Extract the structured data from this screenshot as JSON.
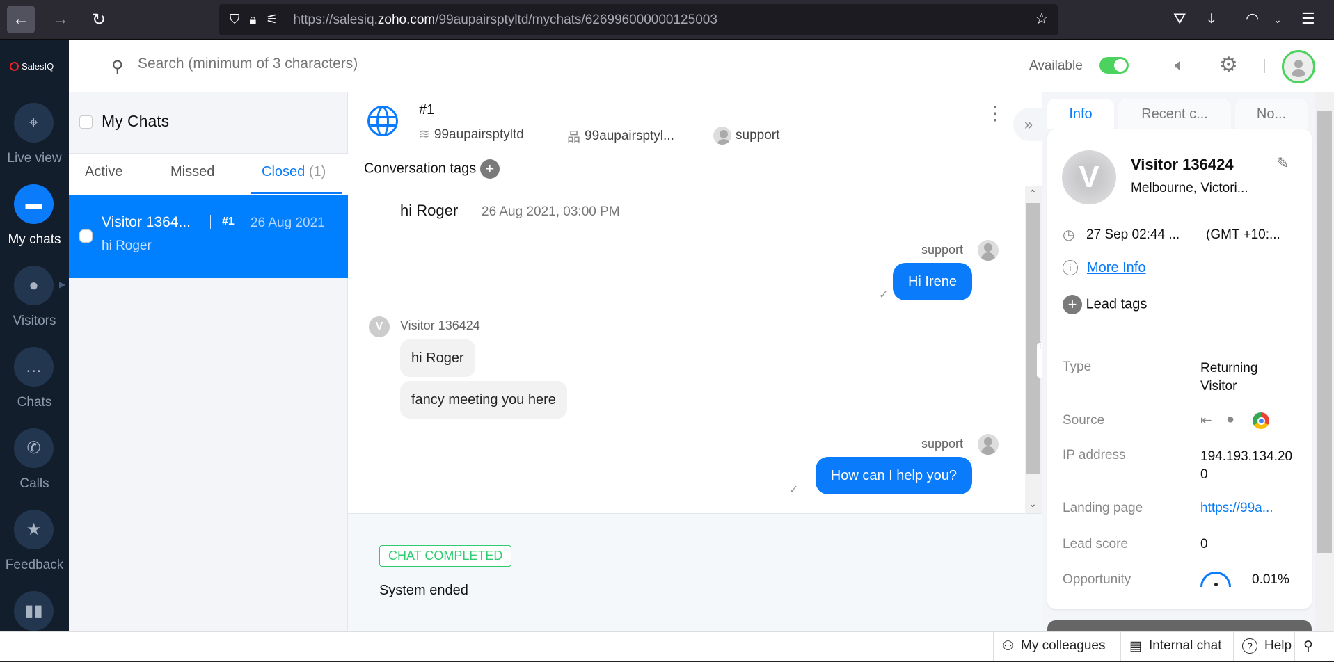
{
  "browser": {
    "url_prefix": "https://salesiq.",
    "url_domain": "zoho.com",
    "url_path": "/99aupairsptyltd/mychats/626996000000125003"
  },
  "sidebar": {
    "logo": "SalesIQ",
    "items": [
      {
        "label": "Live view"
      },
      {
        "label": "My chats"
      },
      {
        "label": "Visitors"
      },
      {
        "label": "Chats"
      },
      {
        "label": "Calls"
      },
      {
        "label": "Feedback"
      }
    ]
  },
  "topbar": {
    "search_placeholder": "Search (minimum of 3 characters)",
    "status": "Available"
  },
  "chatlist": {
    "title": "My Chats",
    "tabs": {
      "active": "Active",
      "missed": "Missed",
      "closed": "Closed",
      "closed_count": "(1)"
    },
    "items": [
      {
        "name": "Visitor 1364...",
        "id": "#1",
        "date": "26 Aug 2021",
        "preview": "hi Roger"
      }
    ]
  },
  "chat": {
    "id": "#1",
    "portal": "99aupairsptyltd",
    "department": "99aupairsptyl...",
    "operator": "support",
    "tags_label": "Conversation tags",
    "question": "hi Roger",
    "question_time": "26 Aug 2021, 03:00 PM",
    "messages": [
      {
        "sender": "support",
        "text": "Hi Irene"
      },
      {
        "sender": "Visitor 136424",
        "text": "hi Roger"
      },
      {
        "sender": "",
        "text": "fancy meeting you here"
      },
      {
        "sender": "support",
        "text": "How can I help you?"
      }
    ],
    "status_badge": "CHAT COMPLETED",
    "end_note": "System ended"
  },
  "info": {
    "tabs": [
      "Info",
      "Recent c...",
      "No..."
    ],
    "name": "Visitor 136424",
    "location": "Melbourne, Victori...",
    "time": "27 Sep 02:44 ...",
    "timezone": "(GMT +10:...",
    "more_info": "More Info",
    "lead_tags": "Lead tags",
    "fields": {
      "type_label": "Type",
      "type_value": "Returning Visitor",
      "source_label": "Source",
      "ip_label": "IP address",
      "ip_value": "194.193.134.200",
      "landing_label": "Landing page",
      "landing_value": "https://99a...",
      "score_label": "Lead score",
      "score_value": "0",
      "opp_label": "Opportunity",
      "opp_value": "0.01%"
    }
  },
  "footer": {
    "colleagues": "My colleagues",
    "internal": "Internal chat",
    "help": "Help"
  }
}
